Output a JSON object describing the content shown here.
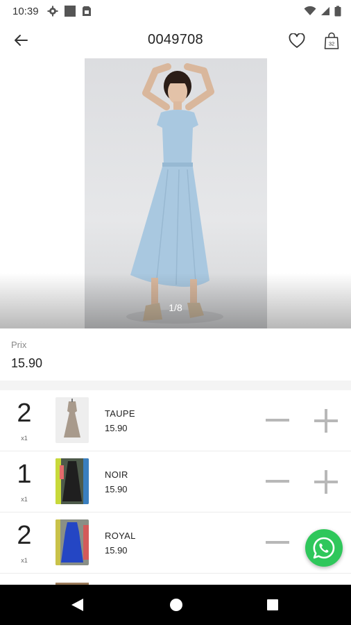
{
  "status_bar": {
    "time": "10:39",
    "left_icons": [
      "gear-icon",
      "square-icon",
      "sim-card-icon"
    ],
    "right_icons": [
      "wifi-icon",
      "signal-icon",
      "battery-icon"
    ]
  },
  "header": {
    "title": "0049708",
    "cart_count": "32"
  },
  "hero": {
    "page_indicator": "1/8"
  },
  "price": {
    "label": "Prix",
    "value": "15.90"
  },
  "variants": [
    {
      "qty": "2",
      "multiplier": "x1",
      "color": "TAUPE",
      "price": "15.90"
    },
    {
      "qty": "1",
      "multiplier": "x1",
      "color": "NOIR",
      "price": "15.90"
    },
    {
      "qty": "2",
      "multiplier": "x1",
      "color": "ROYAL",
      "price": "15.90"
    }
  ],
  "colors": {
    "accent_whatsapp": "#2fc75b",
    "dress_blue": "#a9c8e0",
    "nav_bar": "#000000"
  }
}
